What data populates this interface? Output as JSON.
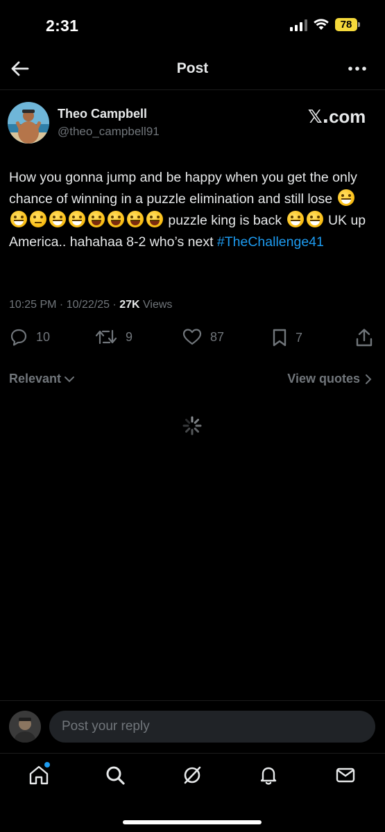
{
  "status_bar": {
    "time": "2:31",
    "battery": "78",
    "battery_color": "#f5d93b"
  },
  "header": {
    "title": "Post",
    "back_icon": "arrow-left-icon",
    "more_icon": "ellipsis-icon"
  },
  "post": {
    "author_name": "Theo Campbell",
    "author_handle": "@theo_campbell91",
    "source_badge": "com",
    "source_badge_mark": "𝕏.",
    "text_part1": "How you gonna jump and be happy when you get the only chance of winning in a puzzle elimination and still lose",
    "text_part2": "puzzle king is back",
    "text_part3": "UK up America.. hahahaa  8-2 who’s next",
    "hashtag": "#TheChallenge41",
    "timestamp": "10:25 PM · 10/22/25 · ",
    "views_count": "27K",
    "views_label": " Views",
    "replies": "10",
    "reposts": "9",
    "likes": "87",
    "bookmarks": "7",
    "link_color": "#1d9bf0"
  },
  "filters": {
    "sort_label": "Relevant",
    "view_quotes_label": "View quotes"
  },
  "reply_bar": {
    "placeholder": "Post your reply"
  },
  "tab_bar": {
    "tabs": [
      "home-icon",
      "search-icon",
      "grok-icon",
      "notifications-icon",
      "messages-icon"
    ]
  }
}
